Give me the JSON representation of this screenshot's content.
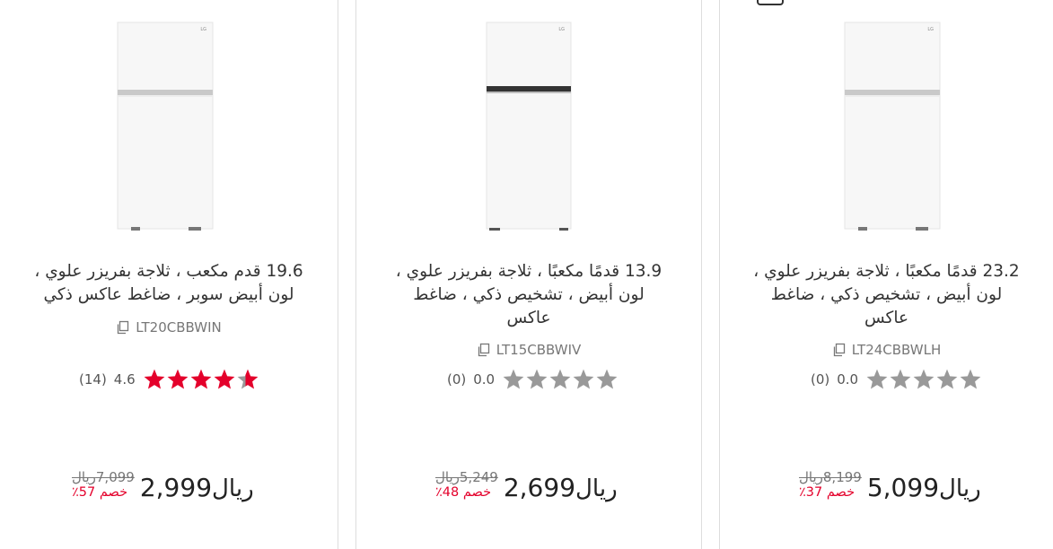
{
  "products": [
    {
      "title_lines": [
        "19.6 قدم مكعب ، ثلاجة بفريزر علوي ،",
        "لون أبيض سوبر ، ضاغط عاكس ذكي"
      ],
      "sku": "LT20CBBWIN",
      "rating": "4.6",
      "reviews": "(14)",
      "stars_filled": 4.6,
      "old_price": "7,099",
      "old_currency": "ريال",
      "discount": "خصم 57٪",
      "price": "2,999",
      "currency": "ريال"
    },
    {
      "title_lines": [
        "13.9 قدمًا مكعبًا ، ثلاجة بفريزر علوي ،",
        "لون أبيض ، تشخيص ذكي ، ضاغط",
        "عاكس"
      ],
      "sku": "LT15CBBWIV",
      "rating": "0.0",
      "reviews": "(0)",
      "stars_filled": 0,
      "old_price": "5,249",
      "old_currency": "ريال",
      "discount": "خصم 48٪",
      "price": "2,699",
      "currency": "ريال"
    },
    {
      "title_lines": [
        "23.2 قدمًا مكعبًا ، ثلاجة بفريزر علوي ،",
        "لون أبيض ، تشخيص ذكي ، ضاغط",
        "عاكس"
      ],
      "sku": "LT24CBBWLH",
      "rating": "0.0",
      "reviews": "(0)",
      "stars_filled": 0,
      "old_price": "8,199",
      "old_currency": "ريال",
      "discount": "خصم 37٪",
      "price": "5,099",
      "currency": "ريال"
    }
  ],
  "colors": {
    "star_filled": "#e4002b",
    "star_empty": "#999999",
    "discount": "#e4002b"
  },
  "icons": {
    "copy": "copy-icon",
    "star": "star-icon",
    "compare": "compare-icon"
  }
}
